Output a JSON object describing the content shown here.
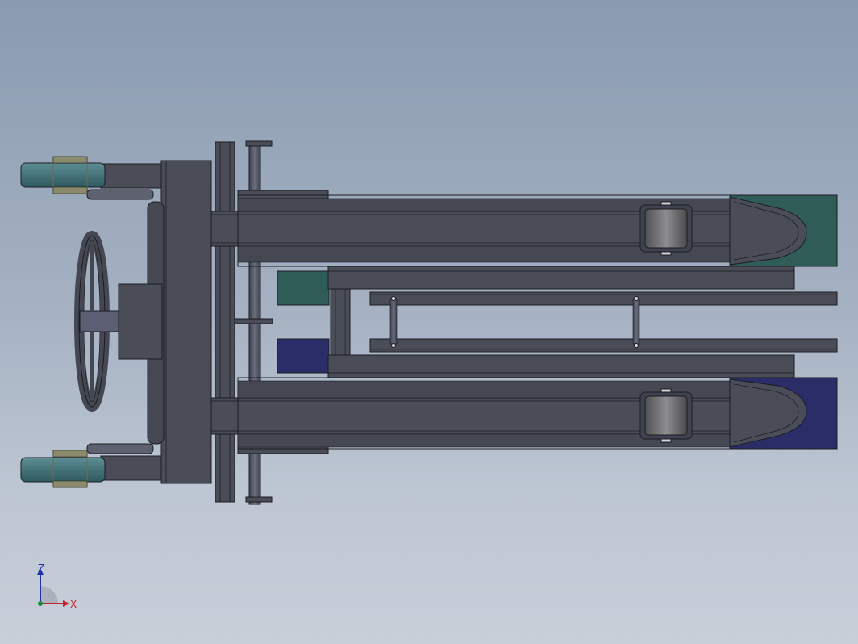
{
  "view": {
    "triad": {
      "z_label": "Z",
      "x_label": "X",
      "z_color": "#1f2fa8",
      "x_color": "#c0262b",
      "origin_color": "#1a8a3a"
    }
  },
  "colors": {
    "background_top": "#8a9bb0",
    "background_bottom": "#c9cfd9",
    "frame": "#4a4c57",
    "frame_edge": "#1c1d22",
    "teal_plate": "#2f5c57",
    "navy_plate": "#2b2d68",
    "wheel": "#3f6d74",
    "roller": "#6d6d70"
  }
}
